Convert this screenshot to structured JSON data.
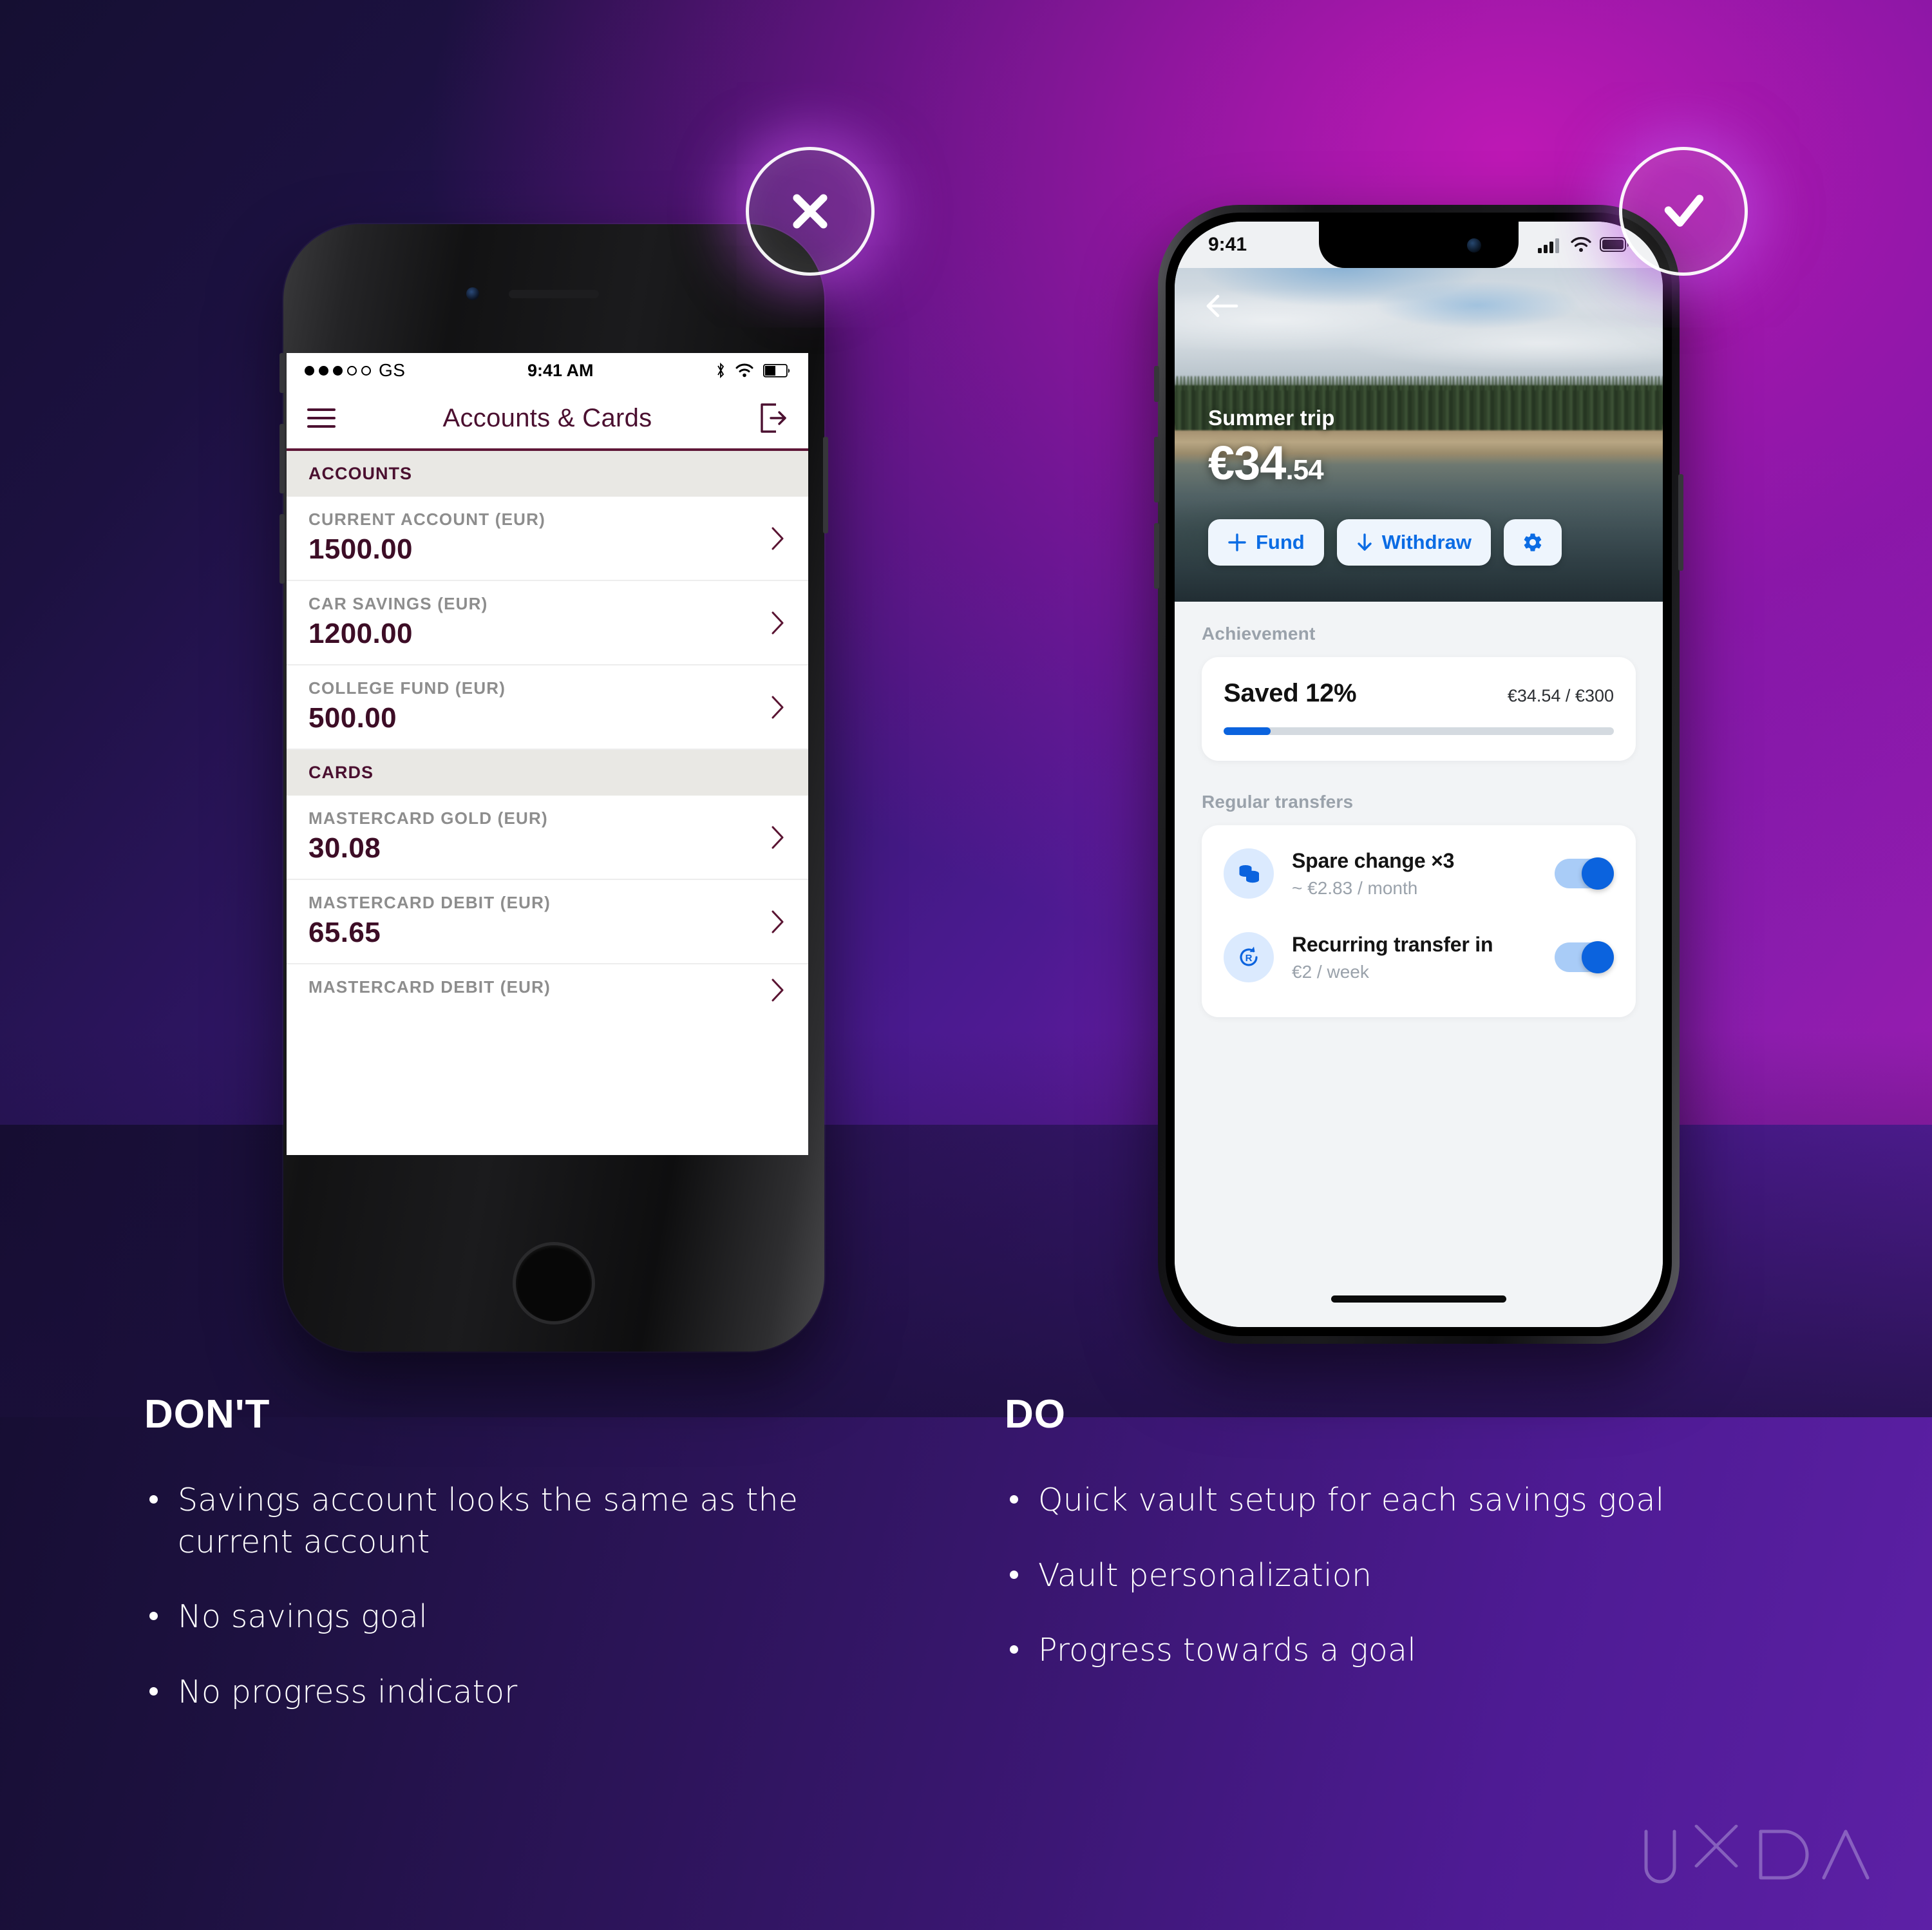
{
  "badges": {
    "bad_icon": "close-x-icon",
    "good_icon": "checkmark-icon"
  },
  "left_phone": {
    "status": {
      "carrier": "GS",
      "time": "9:41 AM",
      "signal_dots": "●●●○○",
      "bluetooth": "bluetooth-icon",
      "wifi": "wifi-icon",
      "battery": "battery-icon"
    },
    "nav": {
      "menu_icon": "hamburger-menu-icon",
      "title": "Accounts & Cards",
      "logout_icon": "logout-icon"
    },
    "sections": [
      {
        "header": "ACCOUNTS",
        "rows": [
          {
            "label": "CURRENT ACCOUNT (EUR)",
            "amount": "1500.00"
          },
          {
            "label": "CAR SAVINGS (EUR)",
            "amount": "1200.00"
          },
          {
            "label": "COLLEGE FUND (EUR)",
            "amount": "500.00"
          }
        ]
      },
      {
        "header": "CARDS",
        "rows": [
          {
            "label": "MASTERCARD GOLD (EUR)",
            "amount": "30.08"
          },
          {
            "label": "MASTERCARD DEBIT (EUR)",
            "amount": "65.65"
          },
          {
            "label": "MASTERCARD DEBIT (EUR)",
            "amount": ""
          }
        ]
      }
    ]
  },
  "right_phone": {
    "status": {
      "time": "9:41",
      "cellular": "cellular-bars-icon",
      "wifi": "wifi-icon",
      "battery": "battery-full-icon"
    },
    "hero": {
      "back_icon": "back-arrow-icon",
      "vault_name": "Summer trip",
      "amount_major": "€34",
      "amount_cents": ".54",
      "actions": [
        {
          "icon": "plus-icon",
          "label": "Fund"
        },
        {
          "icon": "download-arrow-icon",
          "label": "Withdraw"
        },
        {
          "icon": "gear-icon",
          "label": ""
        }
      ]
    },
    "achievement": {
      "section_label": "Achievement",
      "title": "Saved 12%",
      "ratio": "€34.54 / €300",
      "progress_percent": 12
    },
    "transfers": {
      "section_label": "Regular transfers",
      "items": [
        {
          "icon": "coins-stack-icon",
          "name": "Spare change ×3",
          "sub": "~ €2.83 / month",
          "toggle_on": true
        },
        {
          "icon": "recurring-repeat-icon",
          "name": "Recurring transfer in",
          "sub": "€2 / week",
          "toggle_on": true
        }
      ]
    }
  },
  "dont_block": {
    "heading": "DON'T",
    "bullets": [
      "Savings account looks the same as the current account",
      "No savings goal",
      "No progress indicator"
    ]
  },
  "do_block": {
    "heading": "DO",
    "bullets": [
      "Quick vault setup for each savings goal",
      "Vault personalization",
      "Progress towards a goal"
    ]
  },
  "brand": {
    "logo_text": "UXDA"
  },
  "colors": {
    "accent_blue": "#0b63de",
    "maroon": "#4b1030",
    "bg_dark": "#150f32",
    "bg_magenta": "#c41bb4"
  }
}
